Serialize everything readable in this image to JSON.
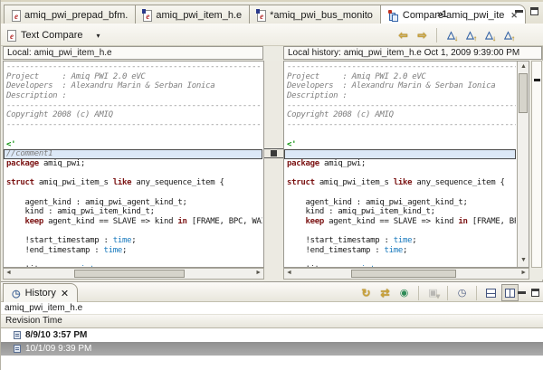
{
  "tabs": [
    {
      "label": "amiq_pwi_prepad_bfm.",
      "icon": "e-file",
      "active": false
    },
    {
      "label": "amiq_pwi_item_h.e",
      "icon": "e-file-marked",
      "active": false
    },
    {
      "label": "*amiq_pwi_bus_monito",
      "icon": "e-file-marked",
      "active": false
    },
    {
      "label": "Compare amiq_pwi_ite",
      "icon": "compare",
      "active": true
    }
  ],
  "tab_overflow_count": "»1",
  "icons": {
    "dropdown": "▾",
    "close": "✕",
    "copy_right_to_left": "⇦",
    "copy_left_to_right": "⇨",
    "triangle": "△",
    "arrow_down": "↓",
    "arrow_up": "↑",
    "refresh": "↻",
    "link_with_editor": "⇄",
    "pin": "◉",
    "compare_mode": "▣",
    "clock": "◷",
    "hscroll_left": "◄",
    "hscroll_right": "►",
    "vscroll_up": "▲",
    "vscroll_down": "▼"
  },
  "compare": {
    "viewer_label": "Text Compare",
    "headers": {
      "left": "Local: amiq_pwi_item_h.e",
      "right": "Local history: amiq_pwi_item_h.e Oct 1, 2009 9:39:00 PM"
    },
    "left": {
      "lines": [
        {
          "segs": [
            [
              "cm",
              "----------------------------------------------------------------------"
            ]
          ]
        },
        {
          "segs": [
            [
              "cm",
              "Project     : Amiq PWI 2.0 eVC"
            ]
          ]
        },
        {
          "segs": [
            [
              "cm",
              "Developers  : Alexandru Marin & Serban Ionica"
            ]
          ]
        },
        {
          "segs": [
            [
              "cm",
              "Description :"
            ]
          ]
        },
        {
          "segs": [
            [
              "cm",
              "----------------------------------------------------------------------"
            ]
          ]
        },
        {
          "segs": [
            [
              "cm",
              "Copyright 2008 (c) AMIQ"
            ]
          ]
        },
        {
          "segs": [
            [
              "cm",
              "----------------------------------------------------------------------"
            ]
          ]
        },
        {
          "segs": []
        },
        {
          "segs": [
            [
              "gr",
              "<'"
            ]
          ]
        },
        {
          "diff": true,
          "segs": [
            [
              "cm",
              "//comment1"
            ]
          ]
        },
        {
          "segs": [
            [
              "kw",
              "package"
            ],
            [
              "tx",
              " amiq_pwi;"
            ]
          ]
        },
        {
          "segs": []
        },
        {
          "segs": [
            [
              "kw",
              "struct"
            ],
            [
              "tx",
              " amiq_pwi_item_s "
            ],
            [
              "kw",
              "like"
            ],
            [
              "tx",
              " any_sequence_item {"
            ]
          ]
        },
        {
          "segs": []
        },
        {
          "segs": [
            [
              "tx",
              "    agent_kind : amiq_pwi_agent_kind_t;"
            ]
          ]
        },
        {
          "segs": [
            [
              "tx",
              "    kind : amiq_pwi_item_kind_t;"
            ]
          ]
        },
        {
          "segs": [
            [
              "tx",
              "    "
            ],
            [
              "kw",
              "keep"
            ],
            [
              "tx",
              " agent_kind == SLAVE => kind "
            ],
            [
              "kw",
              "in"
            ],
            [
              "tx",
              " [FRAME, BPC, WAI"
            ]
          ]
        },
        {
          "segs": []
        },
        {
          "segs": [
            [
              "tx",
              "    !start_timestamp : "
            ],
            [
              "ty",
              "time"
            ],
            [
              "tx",
              ";"
            ]
          ]
        },
        {
          "segs": [
            [
              "tx",
              "    !end_timestamp : "
            ],
            [
              "ty",
              "time"
            ],
            [
              "tx",
              ";"
            ]
          ]
        },
        {
          "segs": []
        },
        {
          "segs": [
            [
              "tx",
              "    !item_no : "
            ],
            [
              "ty",
              "uint"
            ],
            [
              "tx",
              ";"
            ]
          ]
        }
      ]
    },
    "right": {
      "lines": [
        {
          "segs": [
            [
              "cm",
              "----------------------------------------------------------------------"
            ]
          ]
        },
        {
          "segs": [
            [
              "cm",
              "Project     : Amiq PWI 2.0 eVC"
            ]
          ]
        },
        {
          "segs": [
            [
              "cm",
              "Developers  : Alexandru Marin & Serban Ionica"
            ]
          ]
        },
        {
          "segs": [
            [
              "cm",
              "Description :"
            ]
          ]
        },
        {
          "segs": [
            [
              "cm",
              "----------------------------------------------------------------------"
            ]
          ]
        },
        {
          "segs": [
            [
              "cm",
              "Copyright 2008 (c) AMIQ"
            ]
          ]
        },
        {
          "segs": [
            [
              "cm",
              "----------------------------------------------------------------------"
            ]
          ]
        },
        {
          "segs": []
        },
        {
          "segs": [
            [
              "gr",
              "<'"
            ]
          ]
        },
        {
          "diff": true,
          "segs": []
        },
        {
          "segs": [
            [
              "kw",
              "package"
            ],
            [
              "tx",
              " amiq_pwi;"
            ]
          ]
        },
        {
          "segs": []
        },
        {
          "segs": [
            [
              "kw",
              "struct"
            ],
            [
              "tx",
              " amiq_pwi_item_s "
            ],
            [
              "kw",
              "like"
            ],
            [
              "tx",
              " any_sequence_item {"
            ]
          ]
        },
        {
          "segs": []
        },
        {
          "segs": [
            [
              "tx",
              "    agent_kind : amiq_pwi_agent_kind_t;"
            ]
          ]
        },
        {
          "segs": [
            [
              "tx",
              "    kind : amiq_pwi_item_kind_t;"
            ]
          ]
        },
        {
          "segs": [
            [
              "tx",
              "    "
            ],
            [
              "kw",
              "keep"
            ],
            [
              "tx",
              " agent_kind == SLAVE => kind "
            ],
            [
              "kw",
              "in"
            ],
            [
              "tx",
              " [FRAME, BPC,"
            ]
          ]
        },
        {
          "segs": []
        },
        {
          "segs": [
            [
              "tx",
              "    !start_timestamp : "
            ],
            [
              "ty",
              "time"
            ],
            [
              "tx",
              ";"
            ]
          ]
        },
        {
          "segs": [
            [
              "tx",
              "    !end_timestamp : "
            ],
            [
              "ty",
              "time"
            ],
            [
              "tx",
              ";"
            ]
          ]
        },
        {
          "segs": []
        },
        {
          "segs": [
            [
              "tx",
              "    !item_no : "
            ],
            [
              "ty",
              "uint"
            ],
            [
              "tx",
              ";"
            ]
          ]
        }
      ]
    }
  },
  "history": {
    "tab": "History",
    "file": "amiq_pwi_item_h.e",
    "column": "Revision Time",
    "rows": [
      {
        "label": "8/9/10 3:57 PM",
        "selected": false
      },
      {
        "label": "10/1/09 9:39 PM",
        "selected": true
      }
    ]
  },
  "colors": {
    "keyword": "#7b1313",
    "type": "#1879bd",
    "comment": "#7e7e7e",
    "e_header_green": "#0a8f0a",
    "diff_fill": "#dce8f7",
    "diff_border": "#4a4a4a",
    "selected_row": "#9a9a9a",
    "chrome": "#ecebe3"
  }
}
